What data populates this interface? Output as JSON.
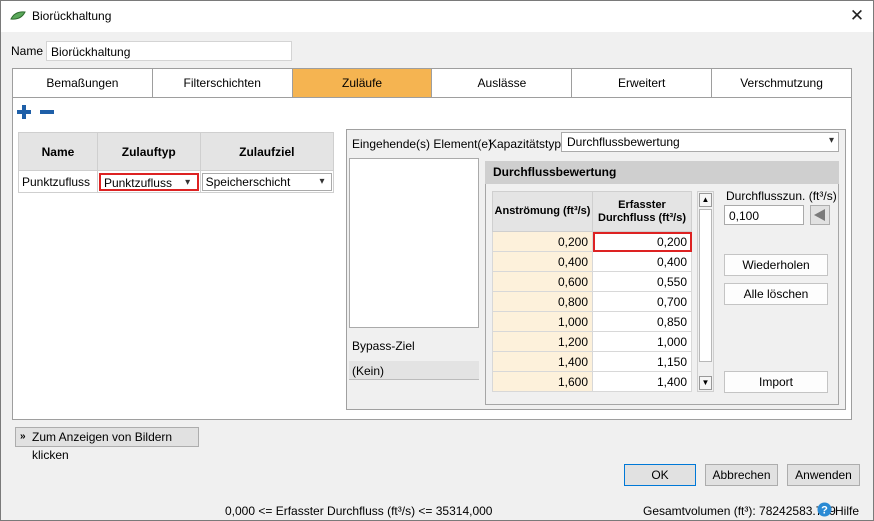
{
  "window": {
    "title": "Biorückhaltung",
    "close_glyph": "✕"
  },
  "name_label": "Name",
  "name_value": "Biorückhaltung",
  "tabs": [
    "Bemaßungen",
    "Filterschichten",
    "Zuläufe",
    "Auslässe",
    "Erweitert",
    "Verschmutzung"
  ],
  "active_tab": "Zuläufe",
  "toolbar": {
    "add_icon": "plus-icon",
    "remove_icon": "minus-icon",
    "accent": "#1e5fa8"
  },
  "inflow_table": {
    "headers": [
      "Name",
      "Zulauftyp",
      "Zulaufziel"
    ],
    "rows": [
      {
        "name": "Punktzufluss",
        "type": "Punktzufluss",
        "target": "Speicherschicht"
      }
    ]
  },
  "right": {
    "incoming_label": "Eingehende(s) Element(e)",
    "capacity_label": "Kapazitätstyp",
    "capacity_value": "Durchflussbewertung",
    "bypass_label": "Bypass-Ziel",
    "bypass_value": "(Kein)"
  },
  "rating": {
    "title": "Durchflussbewertung",
    "col0": "Anströmung (ft³/s)",
    "col1_line1": "Erfasster",
    "col1_line2": "Durchfluss (ft³/s)",
    "rows": [
      [
        "0,200",
        "0,200"
      ],
      [
        "0,400",
        "0,400"
      ],
      [
        "0,600",
        "0,550"
      ],
      [
        "0,800",
        "0,700"
      ],
      [
        "1,000",
        "0,850"
      ],
      [
        "1,200",
        "1,000"
      ],
      [
        "1,400",
        "1,150"
      ],
      [
        "1,600",
        "1,400"
      ]
    ],
    "increment_label": "Durchflusszun. (ft³/s)",
    "increment_value": "0,100",
    "btn_repeat": "Wiederholen",
    "btn_clear": "Alle löschen",
    "btn_import": "Import"
  },
  "show_images": "Zum Anzeigen von Bildern klicken",
  "buttons": {
    "ok": "OK",
    "cancel": "Abbrechen",
    "apply": "Anwenden"
  },
  "status": {
    "constraint": "0,000 <= Erfasster Durchfluss (ft³/s) <= 35314,000",
    "total_volume": "Gesamtvolumen (ft³): 78242583.789",
    "help": "Hilfe"
  },
  "colors": {
    "active_tab": "#f5b451",
    "grid_left": "#fdf1db",
    "selection": "#dd2222"
  }
}
